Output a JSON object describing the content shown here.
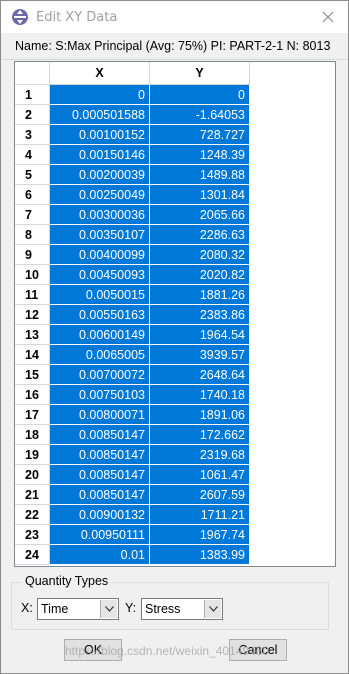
{
  "window": {
    "title": "Edit XY Data",
    "name_line": "Name: S:Max Principal (Avg: 75%) PI: PART-2-1 N: 8013"
  },
  "table": {
    "columns": [
      "X",
      "Y"
    ],
    "rows": [
      {
        "n": "1",
        "x": "0",
        "y": "0"
      },
      {
        "n": "2",
        "x": "0.000501588",
        "y": "-1.64053"
      },
      {
        "n": "3",
        "x": "0.00100152",
        "y": "728.727"
      },
      {
        "n": "4",
        "x": "0.00150146",
        "y": "1248.39"
      },
      {
        "n": "5",
        "x": "0.00200039",
        "y": "1489.88"
      },
      {
        "n": "6",
        "x": "0.00250049",
        "y": "1301.84"
      },
      {
        "n": "7",
        "x": "0.00300036",
        "y": "2065.66"
      },
      {
        "n": "8",
        "x": "0.00350107",
        "y": "2286.63"
      },
      {
        "n": "9",
        "x": "0.00400099",
        "y": "2080.32"
      },
      {
        "n": "10",
        "x": "0.00450093",
        "y": "2020.82"
      },
      {
        "n": "11",
        "x": "0.0050015",
        "y": "1881.26"
      },
      {
        "n": "12",
        "x": "0.00550163",
        "y": "2383.86"
      },
      {
        "n": "13",
        "x": "0.00600149",
        "y": "1964.54"
      },
      {
        "n": "14",
        "x": "0.0065005",
        "y": "3939.57"
      },
      {
        "n": "15",
        "x": "0.00700072",
        "y": "2648.64"
      },
      {
        "n": "16",
        "x": "0.00750103",
        "y": "1740.18"
      },
      {
        "n": "17",
        "x": "0.00800071",
        "y": "1891.06"
      },
      {
        "n": "18",
        "x": "0.00850147",
        "y": "172.662"
      },
      {
        "n": "19",
        "x": "0.00850147",
        "y": "2319.68"
      },
      {
        "n": "20",
        "x": "0.00850147",
        "y": "1061.47"
      },
      {
        "n": "21",
        "x": "0.00850147",
        "y": "2607.59"
      },
      {
        "n": "22",
        "x": "0.00900132",
        "y": "1711.21"
      },
      {
        "n": "23",
        "x": "0.00950111",
        "y": "1967.74"
      },
      {
        "n": "24",
        "x": "0.01",
        "y": "1383.99"
      }
    ]
  },
  "quantity_types": {
    "legend": "Quantity Types",
    "x_label": "X:",
    "x_value": "Time",
    "y_label": "Y:",
    "y_value": "Stress"
  },
  "buttons": {
    "ok": "OK",
    "cancel": "Cancel"
  },
  "watermark": "https://blog.csdn.net/weixin_40149460",
  "colors": {
    "selection": "#0078d7",
    "dialog_bg": "#f0f0f0"
  }
}
